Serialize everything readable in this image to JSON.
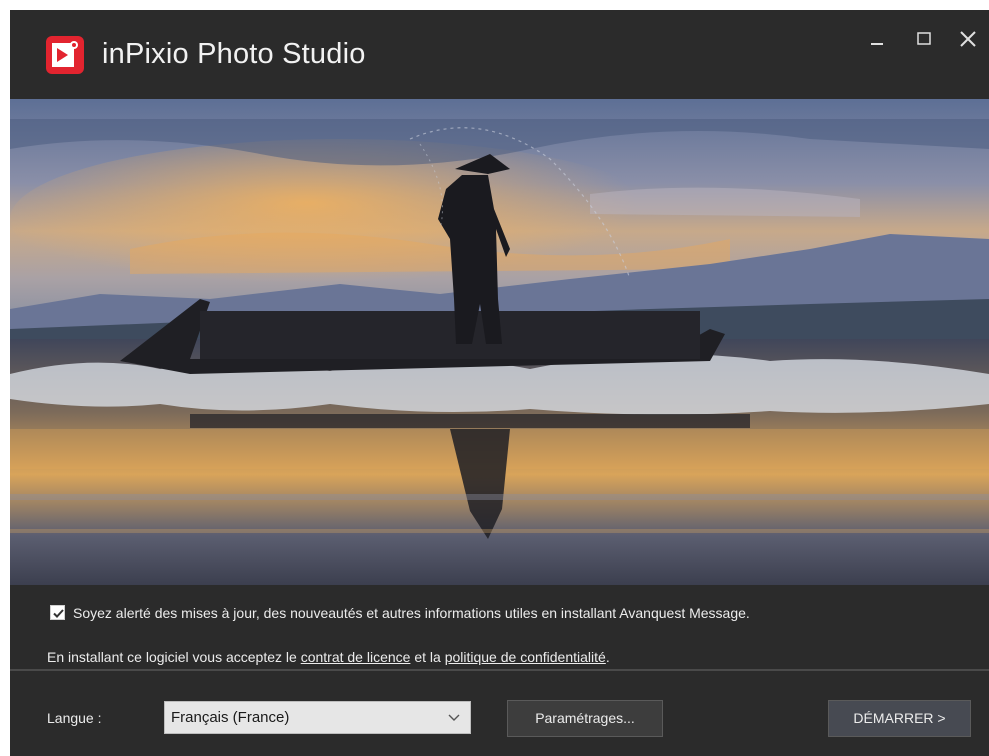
{
  "window": {
    "title": "inPixio Photo Studio",
    "controls": {
      "minimize": "–",
      "maximize": "☐",
      "close": "✕"
    }
  },
  "hero": {
    "description_icon": "fisherman-sunset-photo"
  },
  "options": {
    "update_alert_checked": true,
    "update_alert_label": "Soyez alerté des mises à jour, des nouveautés et autres informations utiles en installant Avanquest Message.",
    "license_prefix": "En installant ce logiciel vous acceptez le ",
    "license_link": "contrat de licence",
    "license_middle": " et la ",
    "privacy_link": "politique de confidentialité",
    "license_suffix": "."
  },
  "footer": {
    "language_label": "Langue :",
    "language_value": "Français (France)",
    "settings_button": "Paramétrages...",
    "start_button": "DÉMARRER  >"
  },
  "colors": {
    "brand": "#e2242f",
    "background": "#2b2b2b",
    "text": "#ececec"
  }
}
